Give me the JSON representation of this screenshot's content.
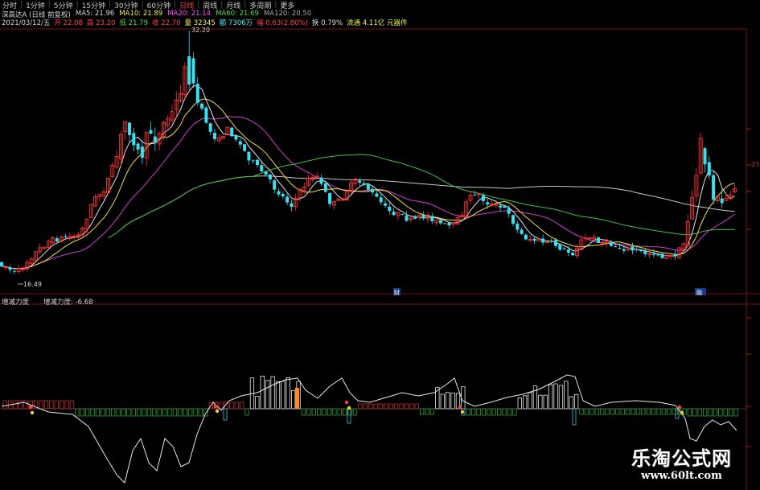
{
  "toolbar": {
    "tabs": [
      "分时",
      "1分钟",
      "5分钟",
      "15分钟",
      "30分钟",
      "60分钟",
      "日线",
      "周线",
      "月线",
      "多周期",
      "更多"
    ],
    "active_index": 6
  },
  "header": {
    "stock": "深高达A (日线 前复权)",
    "ma5": "MA5: 21.96",
    "ma10": "MA10: 21.89",
    "ma20": "MA20: 21.14",
    "ma60": "MA60: 21.69",
    "ma120": "MA120: 20.50",
    "date": "2021/03/12/五",
    "open": "开 22.08",
    "high": "高 23.20",
    "low": "低 21.79",
    "close": "收 22.70",
    "volume": "量 32345",
    "amount": "额 7306万",
    "change": "幅 0.63(2.80%)",
    "turnover": "换 0.79%",
    "float_cap": "流通 4.11亿 元器件"
  },
  "price_labels": {
    "high": "32.20",
    "low": "16.49",
    "right_ticks": [
      "23"
    ]
  },
  "markers": [
    "财",
    "融"
  ],
  "indicator": {
    "name": "增减力度",
    "value_label": "增减力度: -6.68"
  },
  "watermark": {
    "title": "乐淘公式网",
    "url": "www.60lt.com"
  },
  "colors": {
    "up": "#ff3232",
    "down": "#38e0f0",
    "ma5": "#e6e6e6",
    "ma10": "#f0e040",
    "ma20": "#d040d0",
    "ma60": "#40c040",
    "ma120": "#c8c8c8",
    "background": "#000000"
  }
}
